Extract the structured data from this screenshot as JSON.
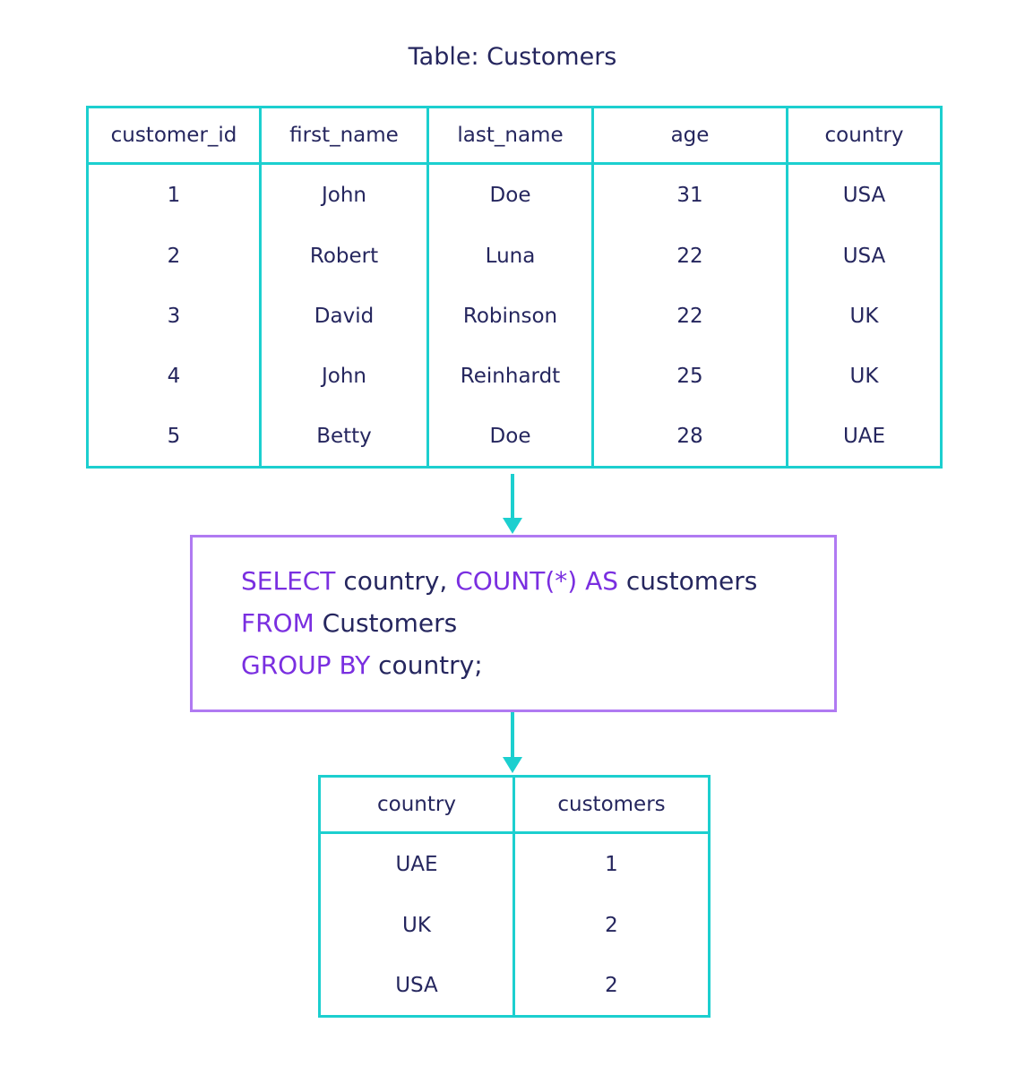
{
  "title": "Table: Customers",
  "customers": {
    "columns": [
      "customer_id",
      "first_name",
      "last_name",
      "age",
      "country"
    ],
    "rows": [
      [
        "1",
        "John",
        "Doe",
        "31",
        "USA"
      ],
      [
        "2",
        "Robert",
        "Luna",
        "22",
        "USA"
      ],
      [
        "3",
        "David",
        "Robinson",
        "22",
        "UK"
      ],
      [
        "4",
        "John",
        "Reinhardt",
        "25",
        "UK"
      ],
      [
        "5",
        "Betty",
        "Doe",
        "28",
        "UAE"
      ]
    ]
  },
  "query": {
    "l1": {
      "k1": "SELECT",
      "t1": " country, ",
      "k2": "COUNT(*) AS",
      "t2": " customers"
    },
    "l2": {
      "k1": "FROM",
      "t1": " Customers"
    },
    "l3": {
      "k1": "GROUP BY",
      "t1": " country;"
    }
  },
  "result": {
    "columns": [
      "country",
      "customers"
    ],
    "rows": [
      [
        "UAE",
        "1"
      ],
      [
        "UK",
        "2"
      ],
      [
        "USA",
        "2"
      ]
    ]
  },
  "colors": {
    "table_border": "#1ccfcf",
    "keyword": "#7a2fe0",
    "text": "#25265e",
    "query_border": "#b07af2"
  }
}
